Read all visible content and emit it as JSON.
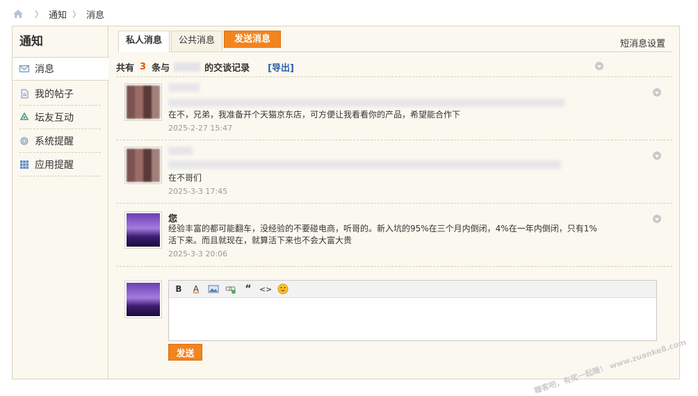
{
  "breadcrumb": {
    "items": [
      "通知",
      "消息"
    ]
  },
  "sidebar": {
    "title": "通知",
    "items": [
      {
        "label": "消息",
        "icon": "envelope-icon"
      },
      {
        "label": "我的帖子",
        "icon": "document-icon"
      },
      {
        "label": "坛友互动",
        "icon": "recycle-icon"
      },
      {
        "label": "系统提醒",
        "icon": "gear-icon"
      },
      {
        "label": "应用提醒",
        "icon": "grid-icon"
      }
    ]
  },
  "tabs": {
    "private": "私人消息",
    "public": "公共消息",
    "send": "发送消息",
    "settings": "短消息设置"
  },
  "summary": {
    "prefix": "共有",
    "count": "3",
    "middle": "条与",
    "suffix": "的交谈记录",
    "export": "[导出]"
  },
  "messages": [
    {
      "author": "",
      "text": "在不，兄弟，我准备开个天猫京东店，可方便让我看看你的产品，希望能合作下",
      "time": "2025-2-27 15:47"
    },
    {
      "author": "",
      "text": "在不哥们",
      "time": "2025-3-3 17:45"
    },
    {
      "author": "您",
      "text": "经验丰富的都可能翻车，没经验的不要碰电商，听哥的。新入坑的95%在三个月内倒闭，4%在一年内倒闭，只有1%活下来。而且就现在，就算活下来也不会大富大贵",
      "time": "2025-3-3 20:06"
    }
  ],
  "editor": {
    "tools": [
      "bold-icon",
      "font-color-icon",
      "image-icon",
      "link-icon",
      "quote-icon",
      "code-icon",
      "emoji-icon"
    ],
    "send": "发送"
  },
  "watermark": "赚客吧，有奖一起赚！ www.zuanke8.com",
  "colors": {
    "accent": "#f3841f",
    "link": "#2c5fa8",
    "count": "#e05a00",
    "panel": "#fbf8ef"
  }
}
